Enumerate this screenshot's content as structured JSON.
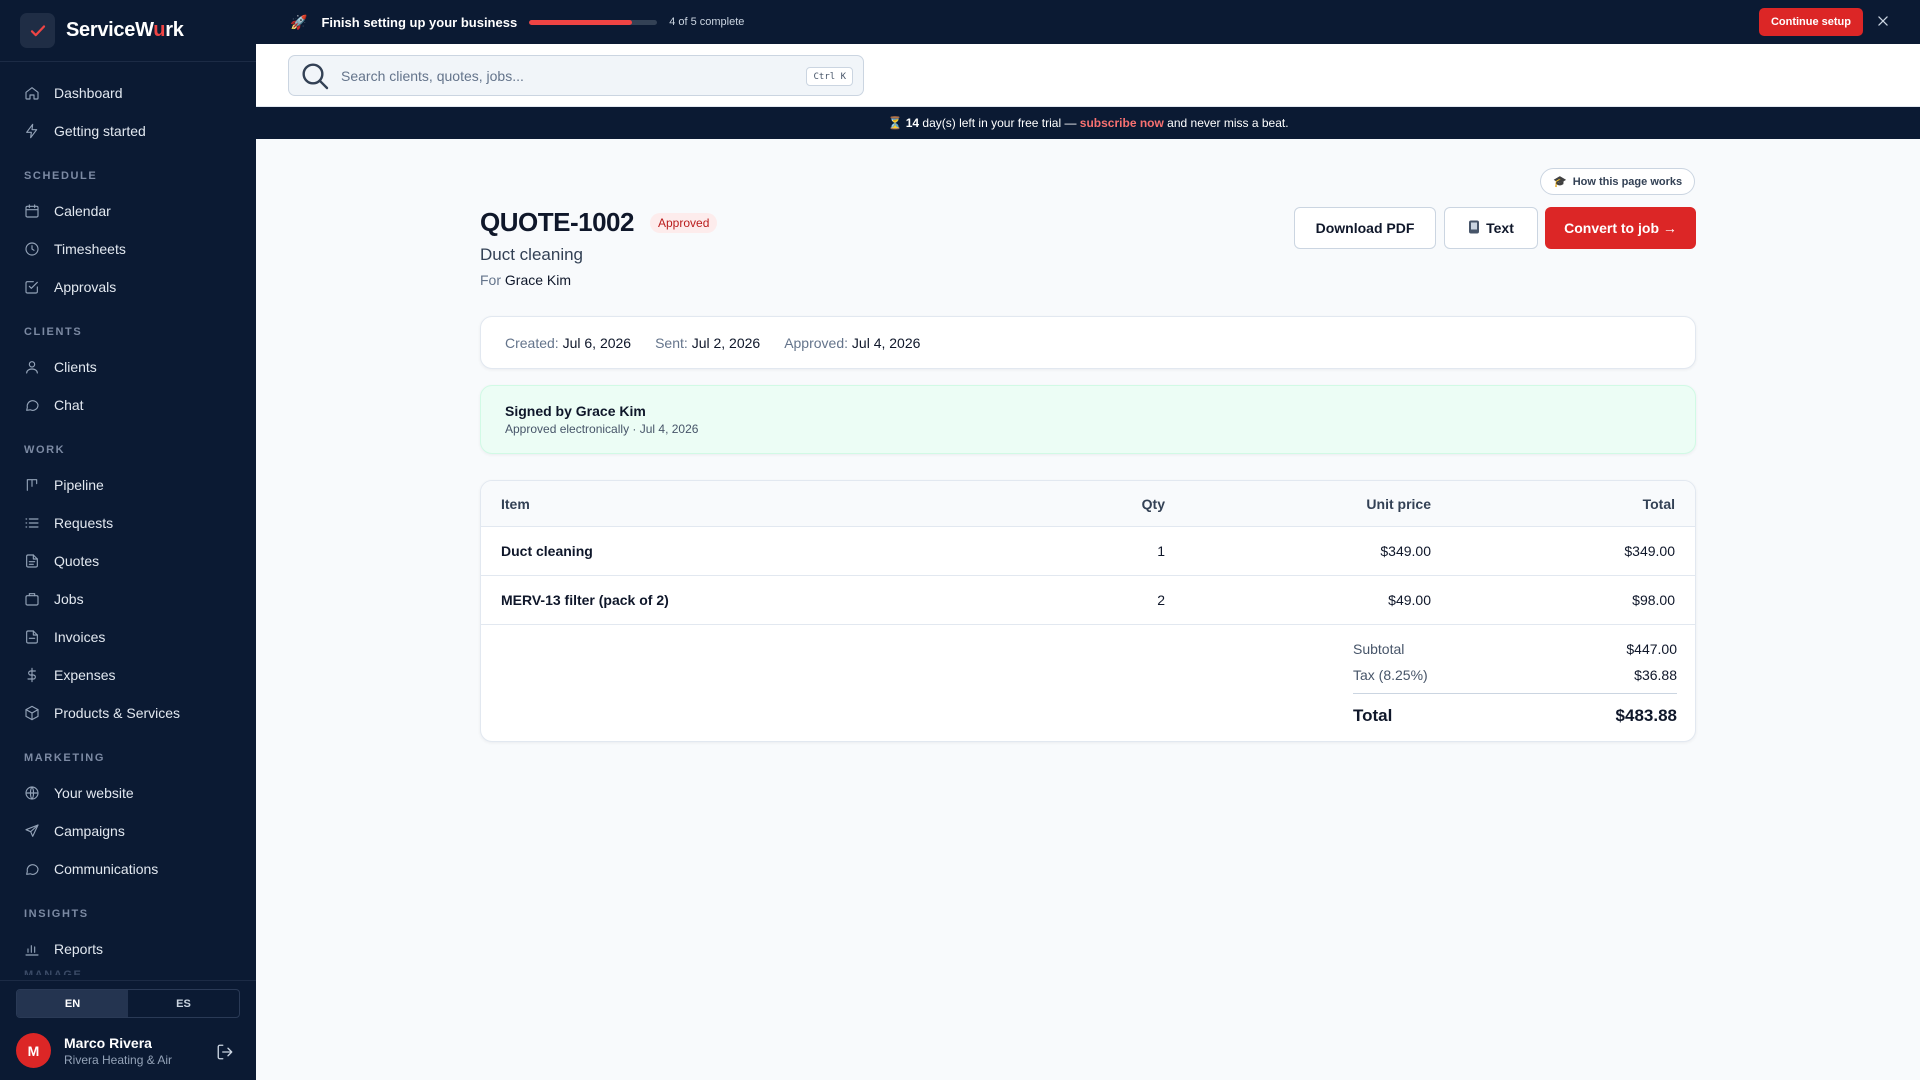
{
  "brand": {
    "name_prefix": "ServiceW",
    "name_accent": "u",
    "name_suffix": "rk"
  },
  "sidebar": {
    "top_items": [
      {
        "label": "Dashboard",
        "icon": "home-icon"
      },
      {
        "label": "Getting started",
        "icon": "lightning-icon"
      }
    ],
    "sections": [
      {
        "title": "SCHEDULE",
        "items": [
          {
            "label": "Calendar",
            "icon": "calendar-icon"
          },
          {
            "label": "Timesheets",
            "icon": "clock-icon"
          },
          {
            "label": "Approvals",
            "icon": "check-square-icon"
          }
        ]
      },
      {
        "title": "CLIENTS",
        "items": [
          {
            "label": "Clients",
            "icon": "user-icon"
          },
          {
            "label": "Chat",
            "icon": "chat-icon"
          }
        ]
      },
      {
        "title": "WORK",
        "items": [
          {
            "label": "Pipeline",
            "icon": "kanban-icon"
          },
          {
            "label": "Requests",
            "icon": "list-icon"
          },
          {
            "label": "Quotes",
            "icon": "document-icon"
          },
          {
            "label": "Jobs",
            "icon": "briefcase-icon"
          },
          {
            "label": "Invoices",
            "icon": "invoice-icon"
          },
          {
            "label": "Expenses",
            "icon": "dollar-icon"
          },
          {
            "label": "Products & Services",
            "icon": "box-icon"
          }
        ]
      },
      {
        "title": "MARKETING",
        "items": [
          {
            "label": "Your website",
            "icon": "globe-icon"
          },
          {
            "label": "Campaigns",
            "icon": "send-icon"
          },
          {
            "label": "Communications",
            "icon": "message-icon"
          }
        ]
      },
      {
        "title": "INSIGHTS",
        "items": [
          {
            "label": "Reports",
            "icon": "bar-chart-icon"
          }
        ]
      }
    ],
    "cut_section": "MANAGE",
    "languages": [
      "EN",
      "ES"
    ],
    "active_language": "EN",
    "user": {
      "initial": "M",
      "name": "Marco Rivera",
      "company": "Rivera Heating & Air"
    }
  },
  "setup": {
    "title": "Finish setting up your business",
    "progress_fraction": 0.8,
    "count_text": "4 of 5 complete",
    "continue_label": "Continue setup"
  },
  "search": {
    "placeholder": "Search clients, quotes, jobs...",
    "shortcut": "Ctrl K"
  },
  "trial": {
    "days": "14",
    "text1": " day(s) left in your free trial — ",
    "link": "subscribe now",
    "text2": " and never miss a beat."
  },
  "quote": {
    "how_label": "How this page works",
    "number": "QUOTE-1002",
    "status": "Approved",
    "description": "Duct cleaning",
    "for_label": "For",
    "client": "Grace Kim",
    "actions": {
      "download": "Download PDF",
      "text": "Text",
      "convert": "Convert to job →"
    },
    "dates": [
      {
        "label": "Created:",
        "value": "Jul 6, 2026"
      },
      {
        "label": "Sent:",
        "value": "Jul 2, 2026"
      },
      {
        "label": "Approved:",
        "value": "Jul 4, 2026"
      }
    ],
    "signature": {
      "title": "Signed by Grace Kim",
      "subtitle": "Approved electronically · Jul 4, 2026"
    },
    "columns": {
      "item": "Item",
      "qty": "Qty",
      "unit_price": "Unit price",
      "total": "Total"
    },
    "line_items": [
      {
        "item": "Duct cleaning",
        "qty": "1",
        "unit_price": "$349.00",
        "total": "$349.00"
      },
      {
        "item": "MERV-13 filter (pack of 2)",
        "qty": "2",
        "unit_price": "$49.00",
        "total": "$98.00"
      }
    ],
    "totals": {
      "subtotal_label": "Subtotal",
      "subtotal": "$447.00",
      "tax_label": "Tax (8.25%)",
      "tax": "$36.88",
      "total_label": "Total",
      "total": "$483.88"
    }
  },
  "colors": {
    "accent": "#dc2626",
    "navy": "#0b1a33",
    "signed_bg": "#ecfdf5"
  }
}
